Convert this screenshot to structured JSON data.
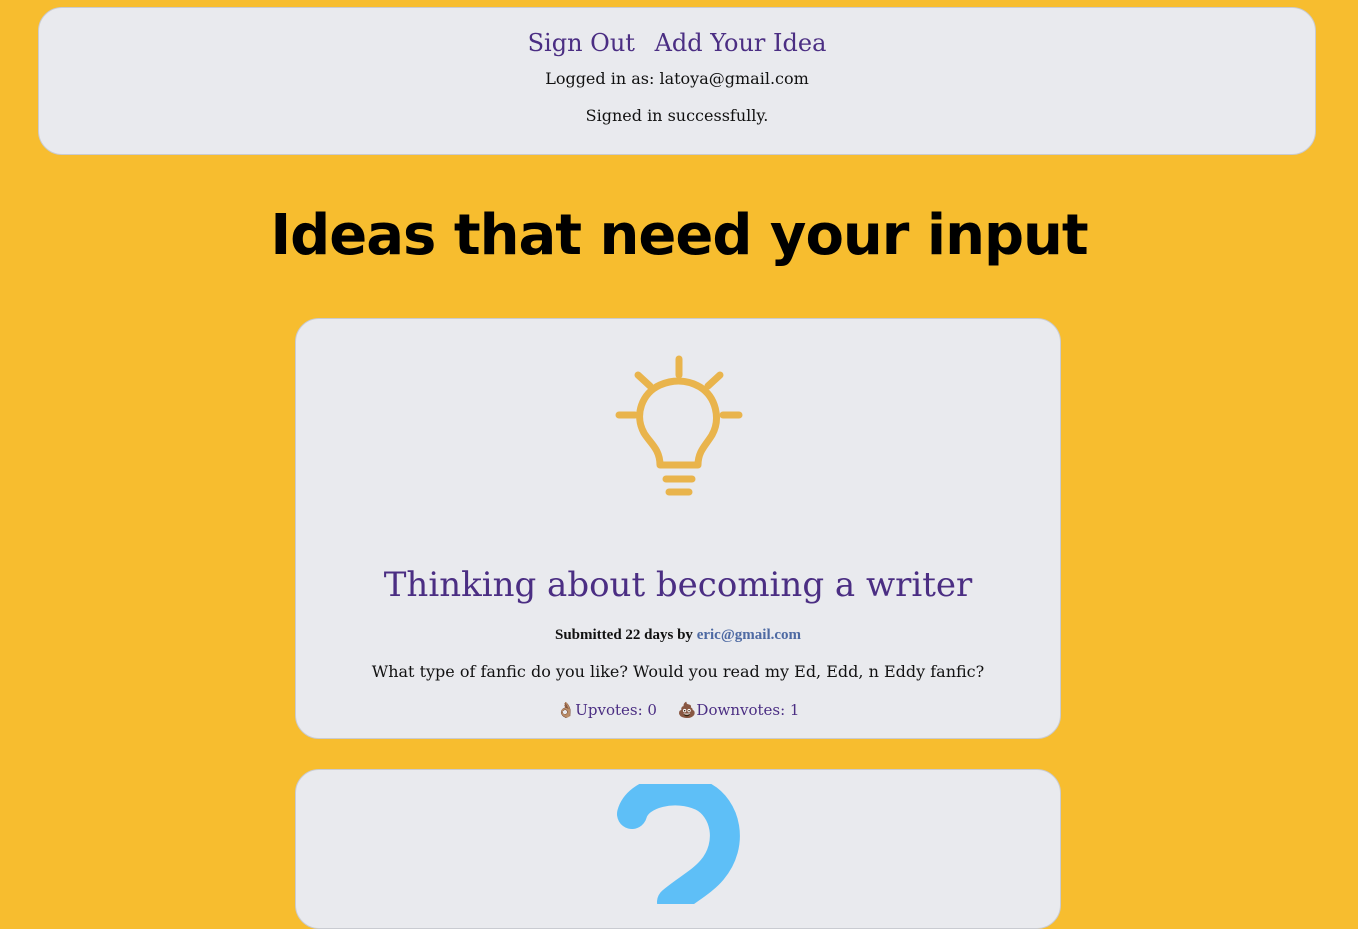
{
  "header": {
    "nav": {
      "sign_out": "Sign Out",
      "add_idea": "Add Your Idea"
    },
    "logged_in_label": "Logged in as: latoya@gmail.com",
    "flash_message": "Signed in successfully."
  },
  "main": {
    "title": "Ideas that need your input",
    "ideas": [
      {
        "icon": "lightbulb-icon",
        "title": "Thinking about becoming a writer",
        "submitted_prefix": "Submitted 22 days by",
        "author": "eric@gmail.com",
        "description": "What type of fanfic do you like? Would you read my Ed, Edd, n Eddy fanfic?",
        "upvote_emoji": "👌🏽",
        "upvotes_label": "Upvotes: 0",
        "downvote_emoji": "💩",
        "downvotes_label": "Downvotes: 1"
      },
      {
        "icon": "question-mark-icon"
      }
    ]
  },
  "colors": {
    "background": "#f7bd2f",
    "card": "#e9eaee",
    "link": "#4b2e83",
    "author_link": "#4e6aa3",
    "bulb": "#e9b44c",
    "question": "#5ebff7"
  }
}
